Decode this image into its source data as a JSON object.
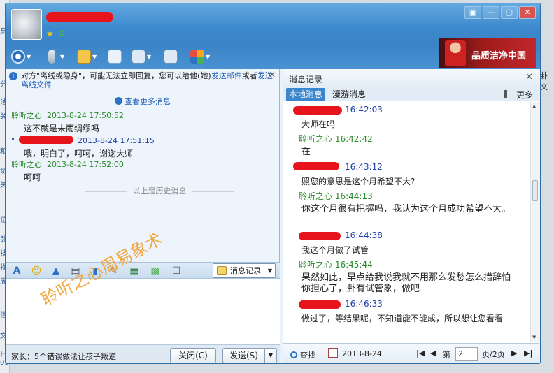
{
  "background": {
    "left_fragments": [
      "息",
      "分",
      "法",
      "关",
      "和",
      "切",
      "关",
      "位",
      "卧",
      "技",
      "找",
      "周",
      "信",
      "文",
      "日",
      "09"
    ],
    "right_fragment": "卦文"
  },
  "window": {
    "title_icons": [
      "★",
      "♻"
    ],
    "window_buttons": [
      "▣",
      "—",
      "▢",
      "✕"
    ]
  },
  "toolbar": {
    "icons": [
      "camera-icon",
      "microphone-icon",
      "file-transfer-icon",
      "add-app-icon",
      "remote-assist-icon",
      "share-screen-icon",
      "apps-icon"
    ]
  },
  "ad_banner": {
    "text": "品质洁净中国"
  },
  "left": {
    "notice": {
      "text_before": "对方\"离线或隐身\"，可能无法立即回复，您可以给他(她)",
      "link1": "发送邮件",
      "text_mid": "或者",
      "link2": "发送离线文件",
      "close": "✕"
    },
    "more_messages": "查看更多消息",
    "messages": [
      {
        "sender": "聆听之心",
        "time": "2013-8-24  17:50:52",
        "body": "这不就是未雨绸缪吗",
        "color": "green"
      },
      {
        "sender": "\"",
        "time": "2013-8-24  17:51:15",
        "body": "哦，明白了，呵呵，谢谢大师",
        "color": "blue"
      },
      {
        "sender": "聆听之心",
        "time": "2013-8-24  17:52:00",
        "body": "呵呵",
        "color": "green"
      }
    ],
    "history_divider": "以上是历史消息",
    "input_tools": [
      "A",
      "☺",
      "▲",
      "▤",
      "✎",
      "▦",
      "▩",
      "☐"
    ],
    "history_button": "消息记录",
    "watermark": "聆听之心周易象术",
    "bottom_text": "家长：5个错误做法让孩子叛逆",
    "close_button": "关闭(C)",
    "send_button": "发送(S)"
  },
  "right": {
    "title": "消息记录",
    "close": "✕",
    "tab_local": "本地消息",
    "tab_roam": "漫游消息",
    "more": "更多",
    "entries": [
      {
        "time": "16:42:03",
        "body": "大师在吗",
        "who": "other"
      },
      {
        "time": "聆听之心 16:42:42",
        "body": "在",
        "who": "me"
      },
      {
        "time": "16:43:12",
        "body": "照您的意思是这个月希望不大?",
        "who": "other"
      },
      {
        "time": "聆听之心 16:44:13",
        "body": "你这个月很有把握吗，我认为这个月成功希望不大。",
        "who": "me"
      },
      {
        "time": "16:44:38",
        "body": "我这个月做了试管",
        "who": "other"
      },
      {
        "time": "聆听之心 16:45:44",
        "body": "果然如此，早点给我说我就不用那么发愁怎么措辞怕你担心了，卦有试管象，做吧",
        "who": "me"
      },
      {
        "time": "16:46:33",
        "body": "做过了，等结果呢，不知道能不能成，所以想让您看看",
        "who": "other"
      }
    ],
    "footer": {
      "search": "查找",
      "date": "2013-8-24",
      "page_prefix": "第",
      "page_value": "2",
      "page_suffix": "页/2页"
    }
  }
}
